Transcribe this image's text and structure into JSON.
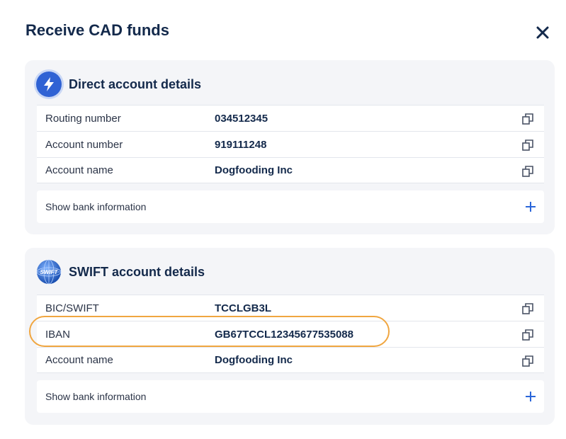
{
  "modal": {
    "title": "Receive CAD funds"
  },
  "direct": {
    "heading": "Direct account details",
    "rows": [
      {
        "label": "Routing number",
        "value": "034512345"
      },
      {
        "label": "Account number",
        "value": "919111248"
      },
      {
        "label": "Account name",
        "value": "Dogfooding Inc"
      }
    ],
    "show_bank_label": "Show bank information"
  },
  "swift": {
    "heading": "SWIFT account details",
    "badge_text": "SWIFT",
    "rows": [
      {
        "label": "BIC/SWIFT",
        "value": "TCCLGB3L"
      },
      {
        "label": "IBAN",
        "value": "GB67TCCL12345677535088"
      },
      {
        "label": "Account name",
        "value": "Dogfooding Inc"
      }
    ],
    "show_bank_label": "Show bank information"
  },
  "colors": {
    "title": "#13294b",
    "accent_blue": "#2b66d9",
    "panel_bg": "#f4f5f8",
    "highlight": "#f0a640"
  },
  "icons": {
    "close": "close-icon",
    "direct_badge": "lightning-icon",
    "swift_badge": "swift-globe-icon",
    "copy": "copy-icon",
    "expand": "plus-icon"
  }
}
